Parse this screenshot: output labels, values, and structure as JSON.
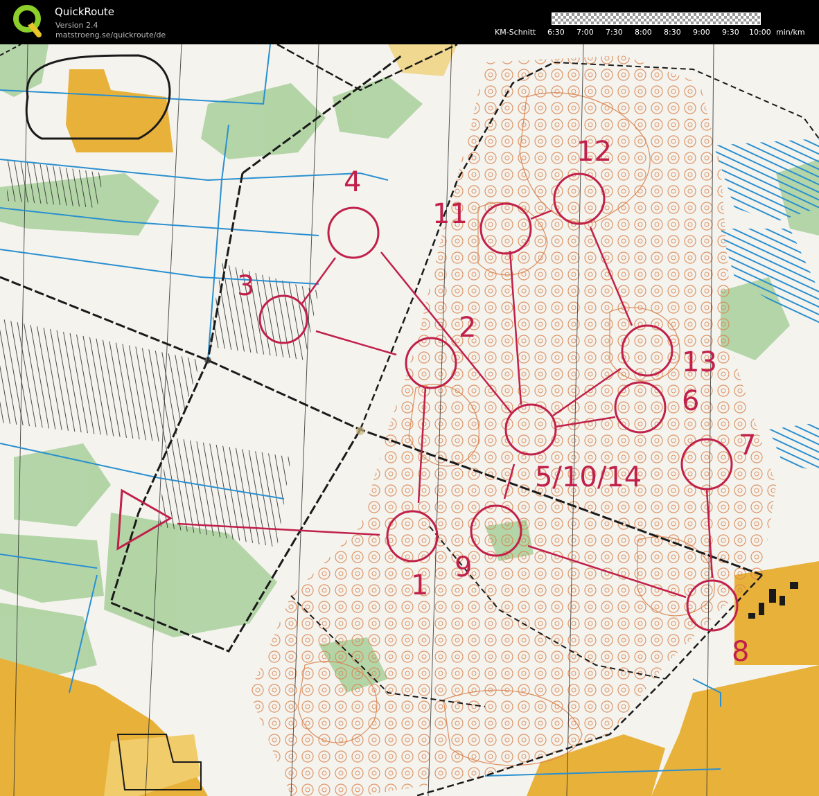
{
  "app": {
    "title": "QuickRoute",
    "version": "Version 2.4",
    "url": "matstroeng.se/quickroute/de"
  },
  "pace_scale": {
    "label": "KM-Schnitt",
    "ticks": [
      "6:30",
      "7:00",
      "7:30",
      "8:00",
      "8:30",
      "9:00",
      "9:30",
      "10:00"
    ],
    "unit": "min/km"
  },
  "map": {
    "controls": [
      "1",
      "2",
      "3",
      "4",
      "5/10/14",
      "6",
      "7",
      "8",
      "9",
      "11",
      "12",
      "13"
    ],
    "colors": {
      "course": "#c0204a",
      "contour": "#d9834f",
      "water": "#2a8fd0",
      "vegetation": "#9ecb8f",
      "open_land": "#e8b23a",
      "paper": "#f4f3ee"
    }
  }
}
